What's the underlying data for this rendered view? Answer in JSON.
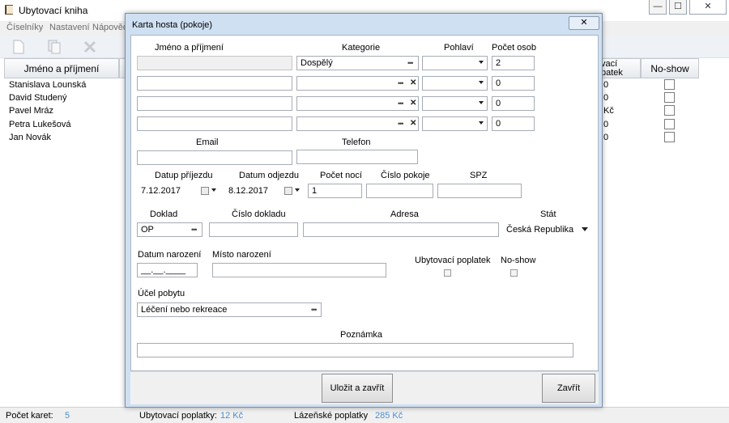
{
  "app": {
    "title": "Ubytovací kniha",
    "controls": {
      "minimize": "—",
      "maximize": "☐",
      "close": "✕"
    }
  },
  "menu": [
    "Číselníky",
    "Nastavení",
    "Nápověda"
  ],
  "toolbar": {
    "icons": [
      "new-document-icon",
      "copy-document-icon",
      "delete-icon"
    ]
  },
  "grid": {
    "columns": [
      "Jméno a příjmení",
      "vací\npatek",
      "No-show"
    ],
    "rows": [
      {
        "name": "Stanislava Lounská",
        "fee": "0"
      },
      {
        "name": "David Studený",
        "fee": "0"
      },
      {
        "name": "Pavel Mráz",
        "fee": "Kč"
      },
      {
        "name": "Petra Lukešová",
        "fee": "0"
      },
      {
        "name": "Jan Novák",
        "fee": "0"
      }
    ]
  },
  "status": {
    "count_label": "Počet karet:",
    "count_value": "5",
    "fee_label": "Ubytovací poplatky:",
    "fee_value": "12 Kč",
    "spa_label": "Lázeňské poplatky",
    "spa_value": "285 Kč"
  },
  "dialog": {
    "title": "Karta hosta (pokoje)",
    "close": "✕",
    "labels": {
      "name": "Jméno a příjmení",
      "category": "Kategorie",
      "gender": "Pohlaví",
      "persons": "Počet osob",
      "email": "Email",
      "phone": "Telefon",
      "arrival": "Datup příjezdu",
      "departure": "Datum odjezdu",
      "nights": "Počet nocí",
      "room": "Číslo pokoje",
      "spz": "SPZ",
      "doc": "Doklad",
      "doc_no": "Číslo dokladu",
      "address": "Adresa",
      "country": "Stát",
      "birth_date": "Datum narození",
      "birth_place": "Místo narození",
      "fee": "Ubytovací poplatek",
      "noshow": "No-show",
      "purpose": "Účel pobytu",
      "note": "Poznámka"
    },
    "values": {
      "category": "Dospělý",
      "persons": [
        "2",
        "0",
        "0",
        "0"
      ],
      "arrival": "7.12.2017",
      "departure": "8.12.2017",
      "nights": "1",
      "doc": "OP",
      "country": "Česká Republika",
      "birth_date": "__.__.____",
      "purpose": "Léčení nebo rekreace"
    },
    "buttons": {
      "save": "Uložit a zavřít",
      "close": "Zavřít"
    }
  }
}
